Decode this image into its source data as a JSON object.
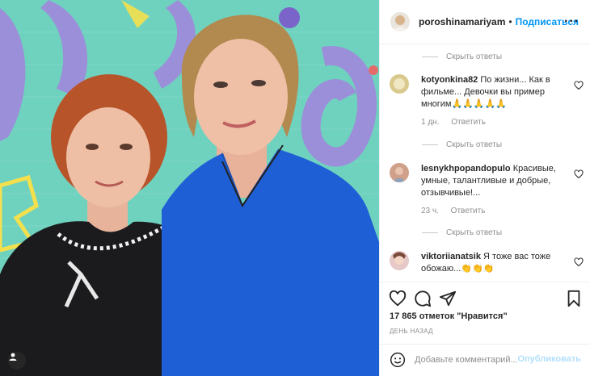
{
  "post": {
    "author": "poroshinamariyam",
    "follow_label": "Подписаться",
    "dot": "•",
    "more_label": "···"
  },
  "icons": {
    "more": "more-options-icon",
    "user_tag": "user-tag-icon",
    "like": "heart-icon",
    "comment": "comment-icon",
    "share": "share-icon",
    "save": "bookmark-icon",
    "emoji": "emoji-icon"
  },
  "comments": {
    "hide_replies_label": "Скрыть ответы",
    "items": [
      {
        "username": "kotyonkina82",
        "text": "По жизни... Как в фильме... Девочки вы пример многим🙏🙏🙏🙏🙏",
        "time": "1 дн.",
        "reply_label": "Ответить"
      },
      {
        "username": "lesnykhpopandopulo",
        "text": "Красивые, умные, талантливые и добрые, отзывчивые!...",
        "time": "23 ч.",
        "reply_label": "Ответить"
      },
      {
        "username": "viktoriianatsik",
        "text": "Я тоже вас тоже обожаю...👏👏👏"
      }
    ]
  },
  "engagement": {
    "likes_text": "17 865 отметок \"Нравится\"",
    "date_text": "ДЕНЬ НАЗАД"
  },
  "add_comment": {
    "placeholder": "Добавьте комментарий...",
    "publish_label": "Опубликовать"
  },
  "colors": {
    "link_blue": "#0095f6",
    "publish_disabled": "#b2dffc",
    "muted": "#8e8e8e",
    "wall_teal": "#6fd2bf",
    "dress_blue": "#1f5fd6"
  }
}
